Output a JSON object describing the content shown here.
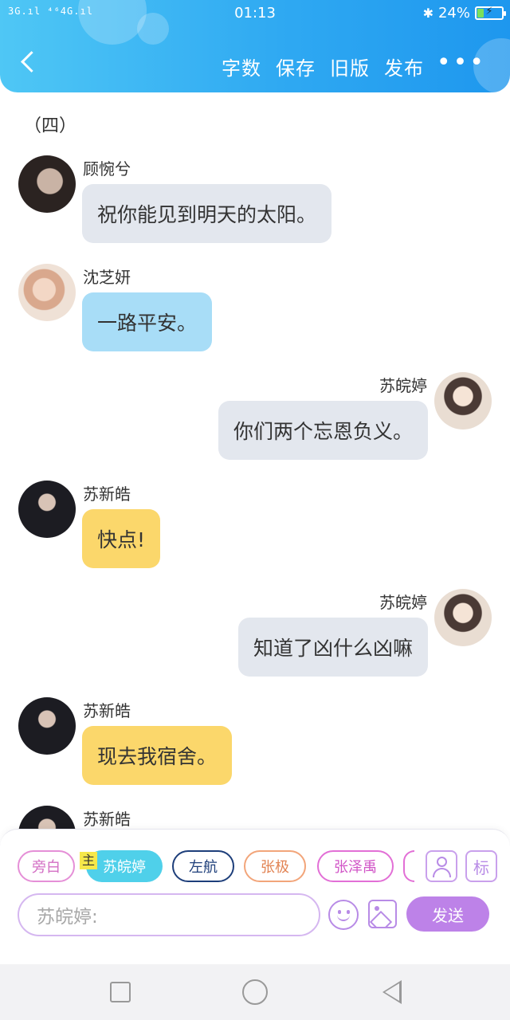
{
  "status_bar": {
    "signal": "3G.ıl ⁴⁶4G.ıl",
    "time": "01:13",
    "battery": "24%",
    "battery_level": 0.24
  },
  "header": {
    "menu": [
      "字数",
      "保存",
      "旧版",
      "发布"
    ],
    "more": "•••"
  },
  "chat": {
    "chapter": "（四）",
    "messages": [
      {
        "speaker": "顾惋兮",
        "text": "祝你能见到明天的太阳。",
        "side": "left",
        "bubble": "grey"
      },
      {
        "speaker": "沈芝妍",
        "text": "一路平安。",
        "side": "left",
        "bubble": "blue"
      },
      {
        "speaker": "苏皖婷",
        "text": "你们两个忘恩负义。",
        "side": "right",
        "bubble": "grey"
      },
      {
        "speaker": "苏新皓",
        "text": "快点!",
        "side": "left",
        "bubble": "yellow"
      },
      {
        "speaker": "苏皖婷",
        "text": "知道了凶什么凶嘛",
        "side": "right",
        "bubble": "grey"
      },
      {
        "speaker": "苏新皓",
        "text": "现去我宿舍。",
        "side": "left",
        "bubble": "yellow"
      },
      {
        "speaker": "苏新皓",
        "text": "",
        "side": "left",
        "bubble": "yellow"
      }
    ]
  },
  "composer": {
    "roles": [
      "旁白",
      "苏皖婷",
      "左航",
      "张极",
      "张泽禹"
    ],
    "main_tag": "主",
    "tag_button": "标",
    "input_placeholder": "苏皖婷:",
    "send_label": "发送"
  },
  "colors": {
    "header_gradient": [
      "#4fc7f5",
      "#1e97ee"
    ],
    "bubble_grey": "#e3e7ee",
    "bubble_blue": "#a8ddf7",
    "bubble_yellow": "#fbd76b",
    "accent_purple": "#bd82e8",
    "active_role": "#4fd0ea"
  }
}
